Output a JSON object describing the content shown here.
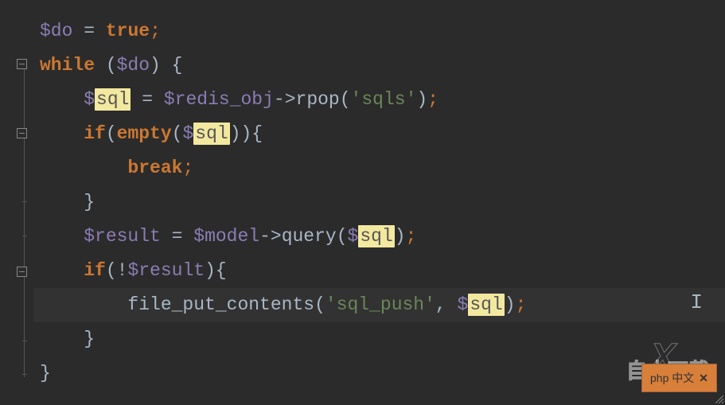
{
  "code": {
    "l1": {
      "var_do": "$do",
      "eq": " = ",
      "true": "true",
      "semi": ";"
    },
    "l2": {
      "while": "while",
      "sp1": " (",
      "var_do": "$do",
      "sp2": ") {"
    },
    "l3": {
      "indent": "    ",
      "dollar": "$",
      "sql_hl": "sql",
      "eq": " = ",
      "var_redis": "$redis_obj",
      "arrow": "->",
      "method": "rpop",
      "p1": "('",
      "str": "sqls",
      "p2": "')",
      "semi": ";"
    },
    "l4": {
      "indent": "    ",
      "if": "if",
      "p1": "(",
      "empty": "empty",
      "p2": "(",
      "dollar": "$",
      "sql_hl": "sql",
      "p3": ")){"
    },
    "l5": {
      "indent": "        ",
      "break": "break",
      "semi": ";"
    },
    "l6": {
      "indent": "    ",
      "brace": "}"
    },
    "l7": {
      "indent": "    ",
      "var_result": "$result",
      "eq": " = ",
      "var_model": "$model",
      "arrow": "->",
      "method": "query",
      "p1": "(",
      "dollar": "$",
      "sql_hl": "sql",
      "p2": ")",
      "semi": ";"
    },
    "l8": {
      "indent": "    ",
      "if": "if",
      "p1": "(!",
      "var_result": "$result",
      "p2": "){"
    },
    "l9": {
      "indent": "        ",
      "method": "file_put_contents",
      "p1": "('",
      "str": "sql_push",
      "p2": "', ",
      "dollar": "$",
      "sql_hl": "sql",
      "p3": ")",
      "semi": ";"
    },
    "l10": {
      "indent": "    ",
      "brace": "}"
    },
    "l11": {
      "brace": "}"
    }
  },
  "watermark": {
    "x": "X",
    "text": "自由下载"
  },
  "bottom_tag": {
    "label": "php 中文",
    "close": "✕"
  }
}
